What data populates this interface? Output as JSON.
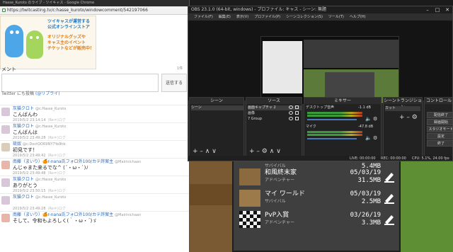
{
  "browser": {
    "title": "Hasse_Kuroto のライブ - ツイキャス - Google Chrome",
    "url": "https://twitcasting.tv/c:hasse_kuroto/windowcomment/542197066",
    "banner": {
      "line1": "ツイキャスが運営する",
      "line2": "公式オンラインストア",
      "line3": "オリジナルグッズや",
      "line4": "キャス主のイベント",
      "line5": "チケットなどが販売中！"
    },
    "comment_heading": "メント",
    "comment_count": "1件",
    "submit_label": "送信する",
    "twitter_text": "Twitter にも投稿",
    "twitter_link": "(@リプライ)",
    "comments": [
      {
        "name": "灰猫クロト",
        "id": "@c:Hasse_Kuroto",
        "text": "こんばんわ",
        "time": "2019/5/2 23:14:14"
      },
      {
        "name": "灰猫クロト",
        "id": "@c:Hasse_Kuroto",
        "text": "こんばんは",
        "time": "2019/5/2 23:49:28"
      },
      {
        "name": "灰猫クロト",
        "id": "@c:Hasse_Kuroto",
        "text": "",
        "time": "2019/5/2 23:49:28"
      },
      {
        "name": "琉奴",
        "id": "@c:DoctOOR9NY7Ya9hb",
        "text": "初見です！",
        "time": "2019/5/2 23:49:42"
      },
      {
        "name": "南藤（まいり）🍊r-nana氏フォロ外100/カテ許案主",
        "id": "@Mairinichaan",
        "text": "んじゃまた来るでな^ (´・ω・`)ﾉ",
        "time": "2019/5/2 23:49:48"
      },
      {
        "name": "灰猫クロト",
        "id": "@c:Hasse_Kuroto",
        "text": "ありがとう",
        "time": "2019/5/2 23:50:15"
      },
      {
        "name": "南藤（まいり）🍊r-nana氏フォロ外100/カテ許案主",
        "id": "@Mairinichaan",
        "text": "そして、令和もよろしく(｀・ω・´)ゞ",
        "time": ""
      }
    ],
    "small_link": "(Reゃ)ログ"
  },
  "obs": {
    "title": "OBS 23.1.0 (64-bit, windows) - プロファイル: キャス - シーン: 無題",
    "menu": [
      "ファイル(F)",
      "編集(E)",
      "表示(V)",
      "プロファイル(P)",
      "シーンコレクション(S)",
      "ツール(T)",
      "ヘルプ(H)"
    ],
    "docks": {
      "scenes": {
        "title": "シーン",
        "items": [
          "シーン"
        ]
      },
      "sources": {
        "title": "ソース",
        "items": [
          "画面キャプチャ 2",
          "画像",
          "7 Group"
        ]
      },
      "mixer": {
        "title": "ミキサー",
        "ch1": "デスクトップ音声",
        "ch1_db": "-1.1 dB",
        "ch2": "マイク",
        "ch2_db": "-47.8 dB"
      },
      "transitions": {
        "title": "シーントランジション",
        "mode": "カット"
      },
      "controls": {
        "title": "コントロール",
        "buttons": [
          "配信終了",
          "録画開始",
          "スタジオモード",
          "設定",
          "終了"
        ]
      }
    },
    "status": {
      "live": "LIVE: 00:00:00",
      "rec": "REC: 00:00:00",
      "cpu": "CPU: 5.1%, 24.00 fps"
    }
  },
  "minecraft": {
    "worlds": [
      {
        "name": "和風終末家",
        "mode": "アドベンチャー",
        "date": "05/03/19",
        "size": "31.5MB"
      },
      {
        "name": "マイ ワールド",
        "mode": "サバイバル",
        "date": "05/03/19",
        "size": "2.5MB"
      },
      {
        "name": "PvP入賞",
        "mode": "アドベンチャー",
        "date": "03/26/19",
        "size": "3.3MB"
      }
    ],
    "partial_row": {
      "mode": "サバイバル",
      "size": "5.4MB"
    }
  },
  "colors": {
    "obs_bg": "#2a2a2a",
    "link": "#2a7bd0",
    "grass": "#6d8f3f"
  }
}
